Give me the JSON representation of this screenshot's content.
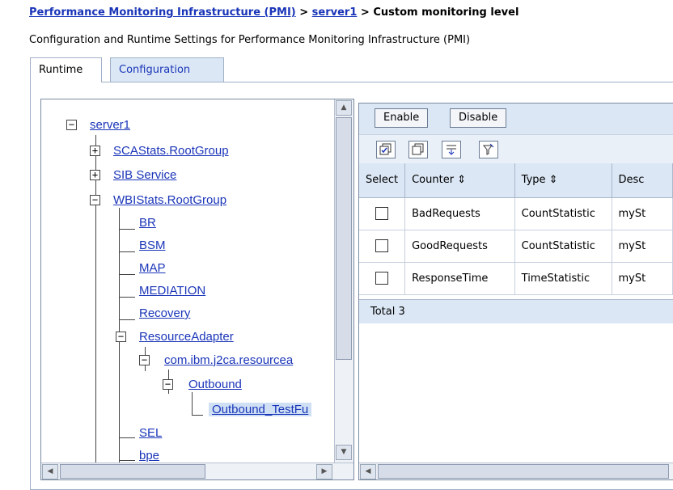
{
  "breadcrumb": {
    "part1": "Performance Monitoring Infrastructure (PMI)",
    "sep1": " > ",
    "part2": "server1",
    "sep2": " > ",
    "current": "Custom monitoring level"
  },
  "subtitle": "Configuration and Runtime Settings for Performance Monitoring Infrastructure (PMI)",
  "tabs": [
    {
      "label": "Runtime",
      "active": true
    },
    {
      "label": "Configuration",
      "active": false
    }
  ],
  "tree": {
    "root": "server1",
    "nodes": {
      "scastats": "SCAStats.RootGroup",
      "sib": "SIB Service",
      "wbistats": "WBIStats.RootGroup",
      "br": "BR",
      "bsm": "BSM",
      "map": "MAP",
      "mediation": "MEDIATION",
      "recovery": "Recovery",
      "resourceadapter": "ResourceAdapter",
      "j2ca": "com.ibm.j2ca.resourcea",
      "outbound": "Outbound",
      "outbound_testfu": "Outbound_TestFu",
      "sel": "SEL",
      "bpe": "bpe"
    }
  },
  "toolbar": {
    "enable": "Enable",
    "disable": "Disable"
  },
  "table": {
    "headers": {
      "select": "Select",
      "counter": "Counter",
      "type": "Type",
      "desc": "Desc"
    },
    "sort_glyph": "⇕",
    "rows": [
      {
        "counter": "BadRequests",
        "type": "CountStatistic",
        "desc": "mySt"
      },
      {
        "counter": "GoodRequests",
        "type": "CountStatistic",
        "desc": "mySt"
      },
      {
        "counter": "ResponseTime",
        "type": "TimeStatistic",
        "desc": "mySt"
      }
    ],
    "total": "Total 3"
  },
  "colors": {
    "link": "#1a35b8",
    "header_bg": "#dbe7f5"
  }
}
